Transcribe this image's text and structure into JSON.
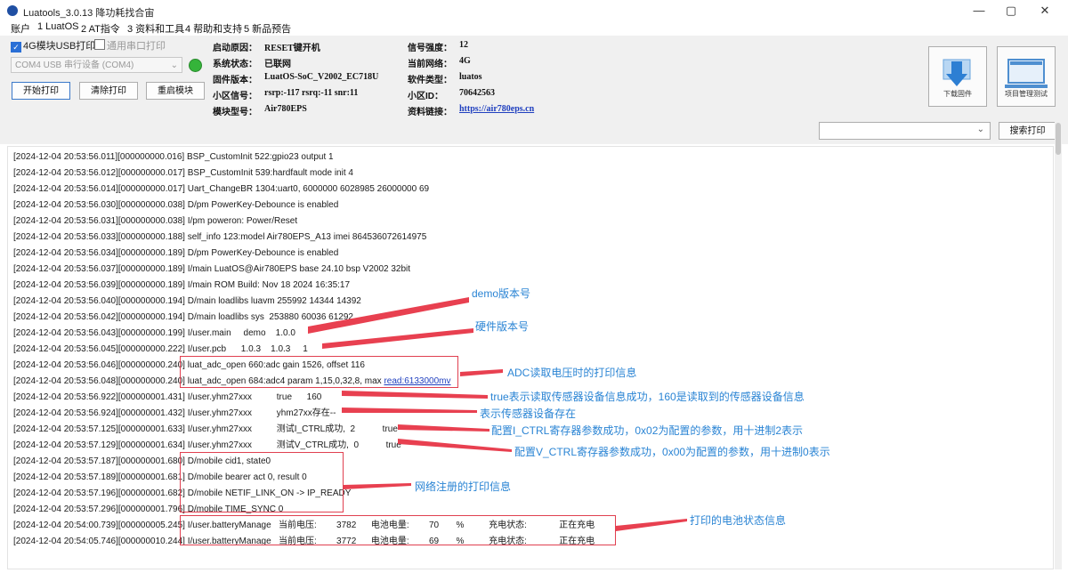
{
  "window": {
    "title": "Luatools_3.0.13 降功耗找合宙",
    "minimize": "—",
    "maximize": "▢",
    "close": "✕"
  },
  "menu": [
    "账户",
    "1 LuatOS",
    "2 AT指令",
    "3 资料和工具",
    "4 帮助和支持",
    "5 新品预告"
  ],
  "options": {
    "usb_checkbox": "4G模块USB打印",
    "usb_checked": true,
    "serial_checkbox": "通用串口打印",
    "serial_checked": false,
    "port_value": "COM4 USB 串行设备 (COM4)",
    "status_color": "#35b43a"
  },
  "buttons": {
    "start": "开始打印",
    "clear": "清除打印",
    "restart": "重启模块",
    "download": "下载固件",
    "project": "项目管理测试",
    "search": "搜索打印"
  },
  "info_left": [
    {
      "label": "启动原因：",
      "value": "RESET键开机"
    },
    {
      "label": "系统状态：",
      "value": "已联网"
    },
    {
      "label": "固件版本：",
      "value": "LuatOS-SoC_V2002_EC718U"
    },
    {
      "label": "小区信号：",
      "value": "rsrp:-117 rsrq:-11 snr:11"
    },
    {
      "label": "模块型号：",
      "value": "Air780EPS"
    }
  ],
  "info_right": [
    {
      "label": "信号强度：",
      "value": "12"
    },
    {
      "label": "当前网络：",
      "value": "4G"
    },
    {
      "label": "软件类型：",
      "value": "luatos"
    },
    {
      "label": "小区ID：",
      "value": "70642563"
    },
    {
      "label": "资料链接：",
      "value": "https://air780eps.cn"
    }
  ],
  "search_value": "",
  "log": [
    {
      "t": "[2024-12-04 20:53:56.011][000000000.016]",
      "m": "BSP_CustomInit 522:gpio23 output 1"
    },
    {
      "t": "[2024-12-04 20:53:56.012][000000000.017]",
      "m": "BSP_CustomInit 539:hardfault mode init 4"
    },
    {
      "t": "[2024-12-04 20:53:56.014][000000000.017]",
      "m": "Uart_ChangeBR 1304:uart0, 6000000 6028985 26000000 69"
    },
    {
      "t": "[2024-12-04 20:53:56.030][000000000.038]",
      "m": "D/pm PowerKey-Debounce is enabled"
    },
    {
      "t": "[2024-12-04 20:53:56.031][000000000.038]",
      "m": "I/pm poweron: Power/Reset"
    },
    {
      "t": "[2024-12-04 20:53:56.033][000000000.188]",
      "m": "self_info 123:model Air780EPS_A13 imei 864536072614975"
    },
    {
      "t": "[2024-12-04 20:53:56.034][000000000.189]",
      "m": "D/pm PowerKey-Debounce is enabled"
    },
    {
      "t": "[2024-12-04 20:53:56.037][000000000.189]",
      "m": "I/main LuatOS@Air780EPS base 24.10 bsp V2002 32bit"
    },
    {
      "t": "[2024-12-04 20:53:56.039][000000000.189]",
      "m": "I/main ROM Build: Nov 18 2024 16:35:17"
    },
    {
      "t": "[2024-12-04 20:53:56.040][000000000.194]",
      "m": "D/main loadlibs luavm 255992 14344 14392"
    },
    {
      "t": "[2024-12-04 20:53:56.042][000000000.194]",
      "m": "D/main loadlibs sys  253880 60036 61292"
    },
    {
      "t": "[2024-12-04 20:53:56.043][000000000.199]",
      "m": "I/user.main     demo    1.0.0"
    },
    {
      "t": "[2024-12-04 20:53:56.045][000000000.222]",
      "m": "I/user.pcb      1.0.3    1.0.3     1"
    },
    {
      "t": "[2024-12-04 20:53:56.046][000000000.240]",
      "m": "luat_adc_open 660:adc gain 1526, offset 116"
    },
    {
      "t": "[2024-12-04 20:53:56.048][000000000.240]",
      "m": "luat_adc_open 684:adc4 param 1,15,0,32,8, max ",
      "link": "read:6133000mv"
    },
    {
      "t": "[2024-12-04 20:53:56.922][000000001.431]",
      "m": "I/user.yhm27xxx          true      160"
    },
    {
      "t": "[2024-12-04 20:53:56.924][000000001.432]",
      "m": "I/user.yhm27xxx          yhm27xx存在--"
    },
    {
      "t": "[2024-12-04 20:53:57.125][000000001.633]",
      "m": "I/user.yhm27xxx          测试I_CTRL成功,  2           true"
    },
    {
      "t": "[2024-12-04 20:53:57.129][000000001.634]",
      "m": "I/user.yhm27xxx          测试V_CTRL成功,  0           true"
    },
    {
      "t": "[2024-12-04 20:53:57.187][000000001.680]",
      "m": "D/mobile cid1, state0"
    },
    {
      "t": "[2024-12-04 20:53:57.189][000000001.681]",
      "m": "D/mobile bearer act 0, result 0"
    },
    {
      "t": "[2024-12-04 20:53:57.196][000000001.682]",
      "m": "D/mobile NETIF_LINK_ON -> IP_READY"
    },
    {
      "t": "[2024-12-04 20:53:57.296][000000001.796]",
      "m": "D/mobile TIME_SYNC 0"
    },
    {
      "t": "[2024-12-04 20:54:00.739][000000005.245]",
      "m": "I/user.batteryManage   当前电压:        3782      电池电量:        70       %          充电状态:             正在充电"
    },
    {
      "t": "[2024-12-04 20:54:05.746][000000010.244]",
      "m": "I/user.batteryManage   当前电压:        3772      电池电量:        69       %          充电状态:             正在充电"
    }
  ],
  "annotations": [
    "demo版本号",
    "硬件版本号",
    "ADC读取电压时的打印信息",
    "true表示读取传感器设备信息成功，160是读取到的传感器设备信息",
    "表示传感器设备存在",
    "配置I_CTRL寄存器参数成功，0x02为配置的参数，用十进制2表示",
    "配置V_CTRL寄存器参数成功，0x00为配置的参数，用十进制0表示",
    "网络注册的打印信息",
    "打印的电池状态信息"
  ],
  "accent": {
    "annotation_text": "#2a84d4",
    "annotation_arrow": "#e84050",
    "highlight_box": "#e04050"
  }
}
